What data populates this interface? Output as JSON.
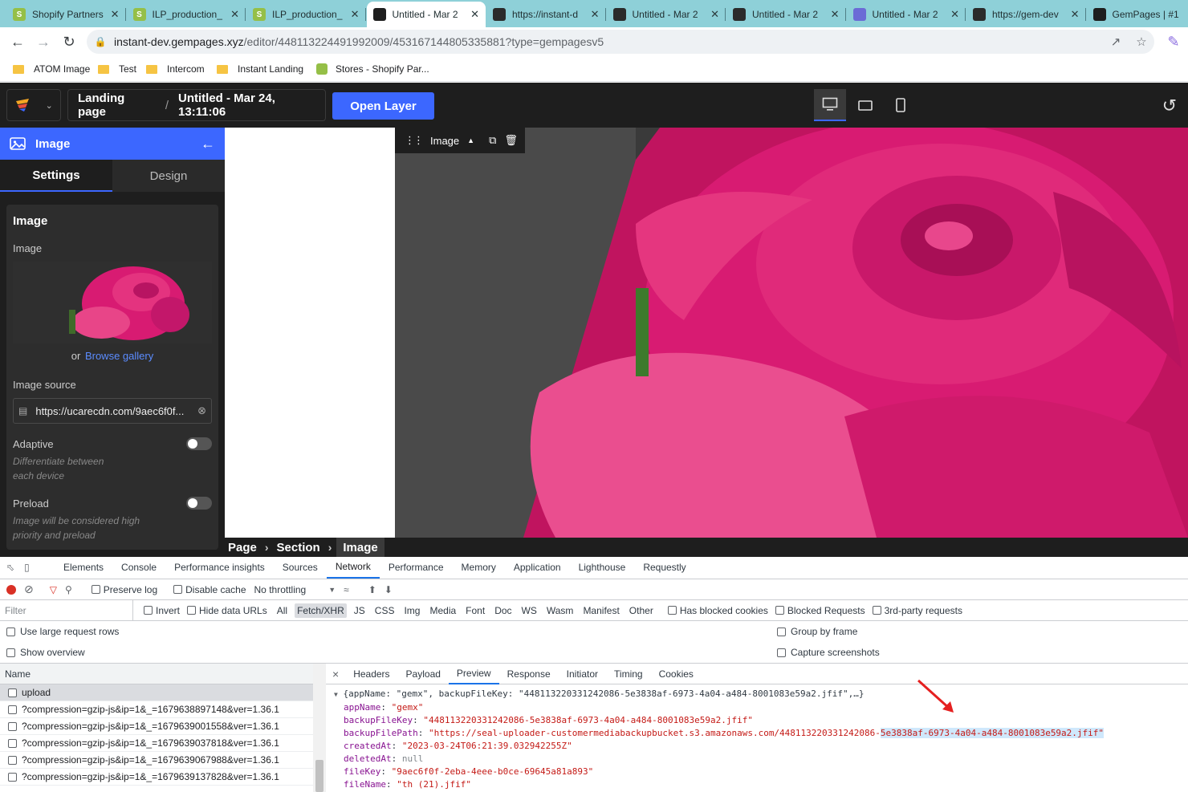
{
  "browser": {
    "tabs": [
      {
        "title": "Shopify Partners",
        "icon": "shopify-icon",
        "kind": "shop"
      },
      {
        "title": "ILP_production_",
        "icon": "shopify-icon",
        "kind": "shop"
      },
      {
        "title": "ILP_production_",
        "icon": "shopify-icon",
        "kind": "shop"
      },
      {
        "title": "Untitled - Mar 2",
        "icon": "gempages-icon",
        "kind": "gp",
        "active": true
      },
      {
        "title": "https://instant-d",
        "icon": "globe-icon",
        "kind": "globe"
      },
      {
        "title": "Untitled - Mar 2",
        "icon": "globe-icon",
        "kind": "globe"
      },
      {
        "title": "Untitled - Mar 2",
        "icon": "globe-icon",
        "kind": "globe"
      },
      {
        "title": "Untitled - Mar 2",
        "icon": "gear-icon",
        "kind": "gear"
      },
      {
        "title": "https://gem-dev",
        "icon": "globe-icon",
        "kind": "globe"
      },
      {
        "title": "GemPages | #1",
        "icon": "gempages-icon",
        "kind": "gp"
      }
    ],
    "url_host": "instant-dev.gempages.xyz",
    "url_path": "/editor/448113224491992009/453167144805335881?type=gempagesv5",
    "bookmarks": [
      "ATOM Image",
      "Test",
      "Intercom",
      "Instant Landing",
      "Stores - Shopify Par..."
    ]
  },
  "editor": {
    "breadcrumb_root": "Landing page",
    "breadcrumb_sep": "/",
    "page_title": "Untitled - Mar 24, 13:11:06",
    "open_layer_label": "Open Layer",
    "device_selected": "desktop"
  },
  "panel": {
    "title": "Image",
    "tabs": [
      "Settings",
      "Design"
    ],
    "section_title": "Image",
    "image_label": "Image",
    "or_text": "or",
    "browse_gallery": "Browse gallery",
    "source_label": "Image source",
    "source_value": "https://ucarecdn.com/9aec6f0f...",
    "adaptive_label": "Adaptive",
    "adaptive_hint": "Differentiate between each device",
    "adaptive_on": false,
    "preload_label": "Preload",
    "preload_hint": "Image will be considered high priority and preload",
    "preload_on": false
  },
  "canvas": {
    "toolbar_label": "Image",
    "crumbs": [
      "Page",
      "Section",
      "Image"
    ]
  },
  "devtools": {
    "tabs": [
      "Elements",
      "Console",
      "Performance insights",
      "Sources",
      "Network",
      "Performance",
      "Memory",
      "Application",
      "Lighthouse",
      "Requestly"
    ],
    "selected_tab": "Network",
    "preserve_log": "Preserve log",
    "disable_cache": "Disable cache",
    "throttling": "No throttling",
    "filter_placeholder": "Filter",
    "invert": "Invert",
    "hide_data_urls": "Hide data URLs",
    "types": [
      "All",
      "Fetch/XHR",
      "JS",
      "CSS",
      "Img",
      "Media",
      "Font",
      "Doc",
      "WS",
      "Wasm",
      "Manifest",
      "Other"
    ],
    "selected_type": "Fetch/XHR",
    "has_blocked_cookies": "Has blocked cookies",
    "blocked_requests": "Blocked Requests",
    "third_party": "3rd-party requests",
    "use_large_rows": "Use large request rows",
    "show_overview": "Show overview",
    "group_by_frame": "Group by frame",
    "capture_screenshots": "Capture screenshots",
    "name_header": "Name",
    "requests": [
      "upload",
      "?compression=gzip-js&ip=1&_=1679638897148&ver=1.36.1",
      "?compression=gzip-js&ip=1&_=1679639001558&ver=1.36.1",
      "?compression=gzip-js&ip=1&_=1679639037818&ver=1.36.1",
      "?compression=gzip-js&ip=1&_=1679639067988&ver=1.36.1",
      "?compression=gzip-js&ip=1&_=1679639137828&ver=1.36.1"
    ],
    "detail_tabs": [
      "Headers",
      "Payload",
      "Preview",
      "Response",
      "Initiator",
      "Timing",
      "Cookies"
    ],
    "selected_detail_tab": "Preview",
    "preview_summary": "{appName: \"gemx\", backupFileKey: \"448113220331242086-5e3838af-6973-4a04-a484-8001083e59a2.jfif\",…}",
    "fields": [
      {
        "key": "appName",
        "value": "\"gemx\"",
        "type": "string"
      },
      {
        "key": "backupFileKey",
        "value": "\"448113220331242086-5e3838af-6973-4a04-a484-8001083e59a2.jfif\"",
        "type": "string"
      },
      {
        "key": "backupFilePath",
        "value_pre": "\"https://seal-uploader-customermediabackupbucket.s3.amazonaws.com/448113220331242086-",
        "value_hl": "5e3838af-6973-4a04-a484-8001083e59a2.jfif\"",
        "type": "string"
      },
      {
        "key": "createdAt",
        "value": "\"2023-03-24T06:21:39.032942255Z\"",
        "type": "string"
      },
      {
        "key": "deletedAt",
        "value": "null",
        "type": "null"
      },
      {
        "key": "fileKey",
        "value": "\"9aec6f0f-2eba-4eee-b0ce-69645a81a893\"",
        "type": "string"
      },
      {
        "key": "fileName",
        "value": "\"th (21).jfif\"",
        "type": "string"
      }
    ]
  }
}
